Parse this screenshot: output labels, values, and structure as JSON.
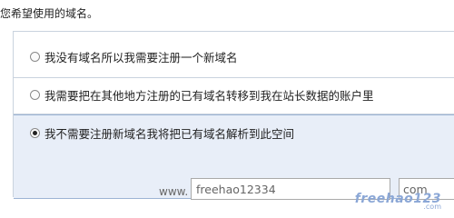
{
  "prompt": "您希望使用的域名。",
  "options": [
    {
      "label": "我没有域名所以我需要注册一个新域名",
      "checked": false
    },
    {
      "label": "我需要把在其他地方注册的已有域名转移到我在站长数据的账户里",
      "checked": false
    },
    {
      "label": "我不需要注册新域名我将把已有域名解析到此空间",
      "checked": true
    }
  ],
  "domain": {
    "prefix": "www.",
    "name_value": "freehao12334",
    "tld_value": "com"
  },
  "watermark": {
    "main": "freehao123",
    "sub": ".com"
  }
}
